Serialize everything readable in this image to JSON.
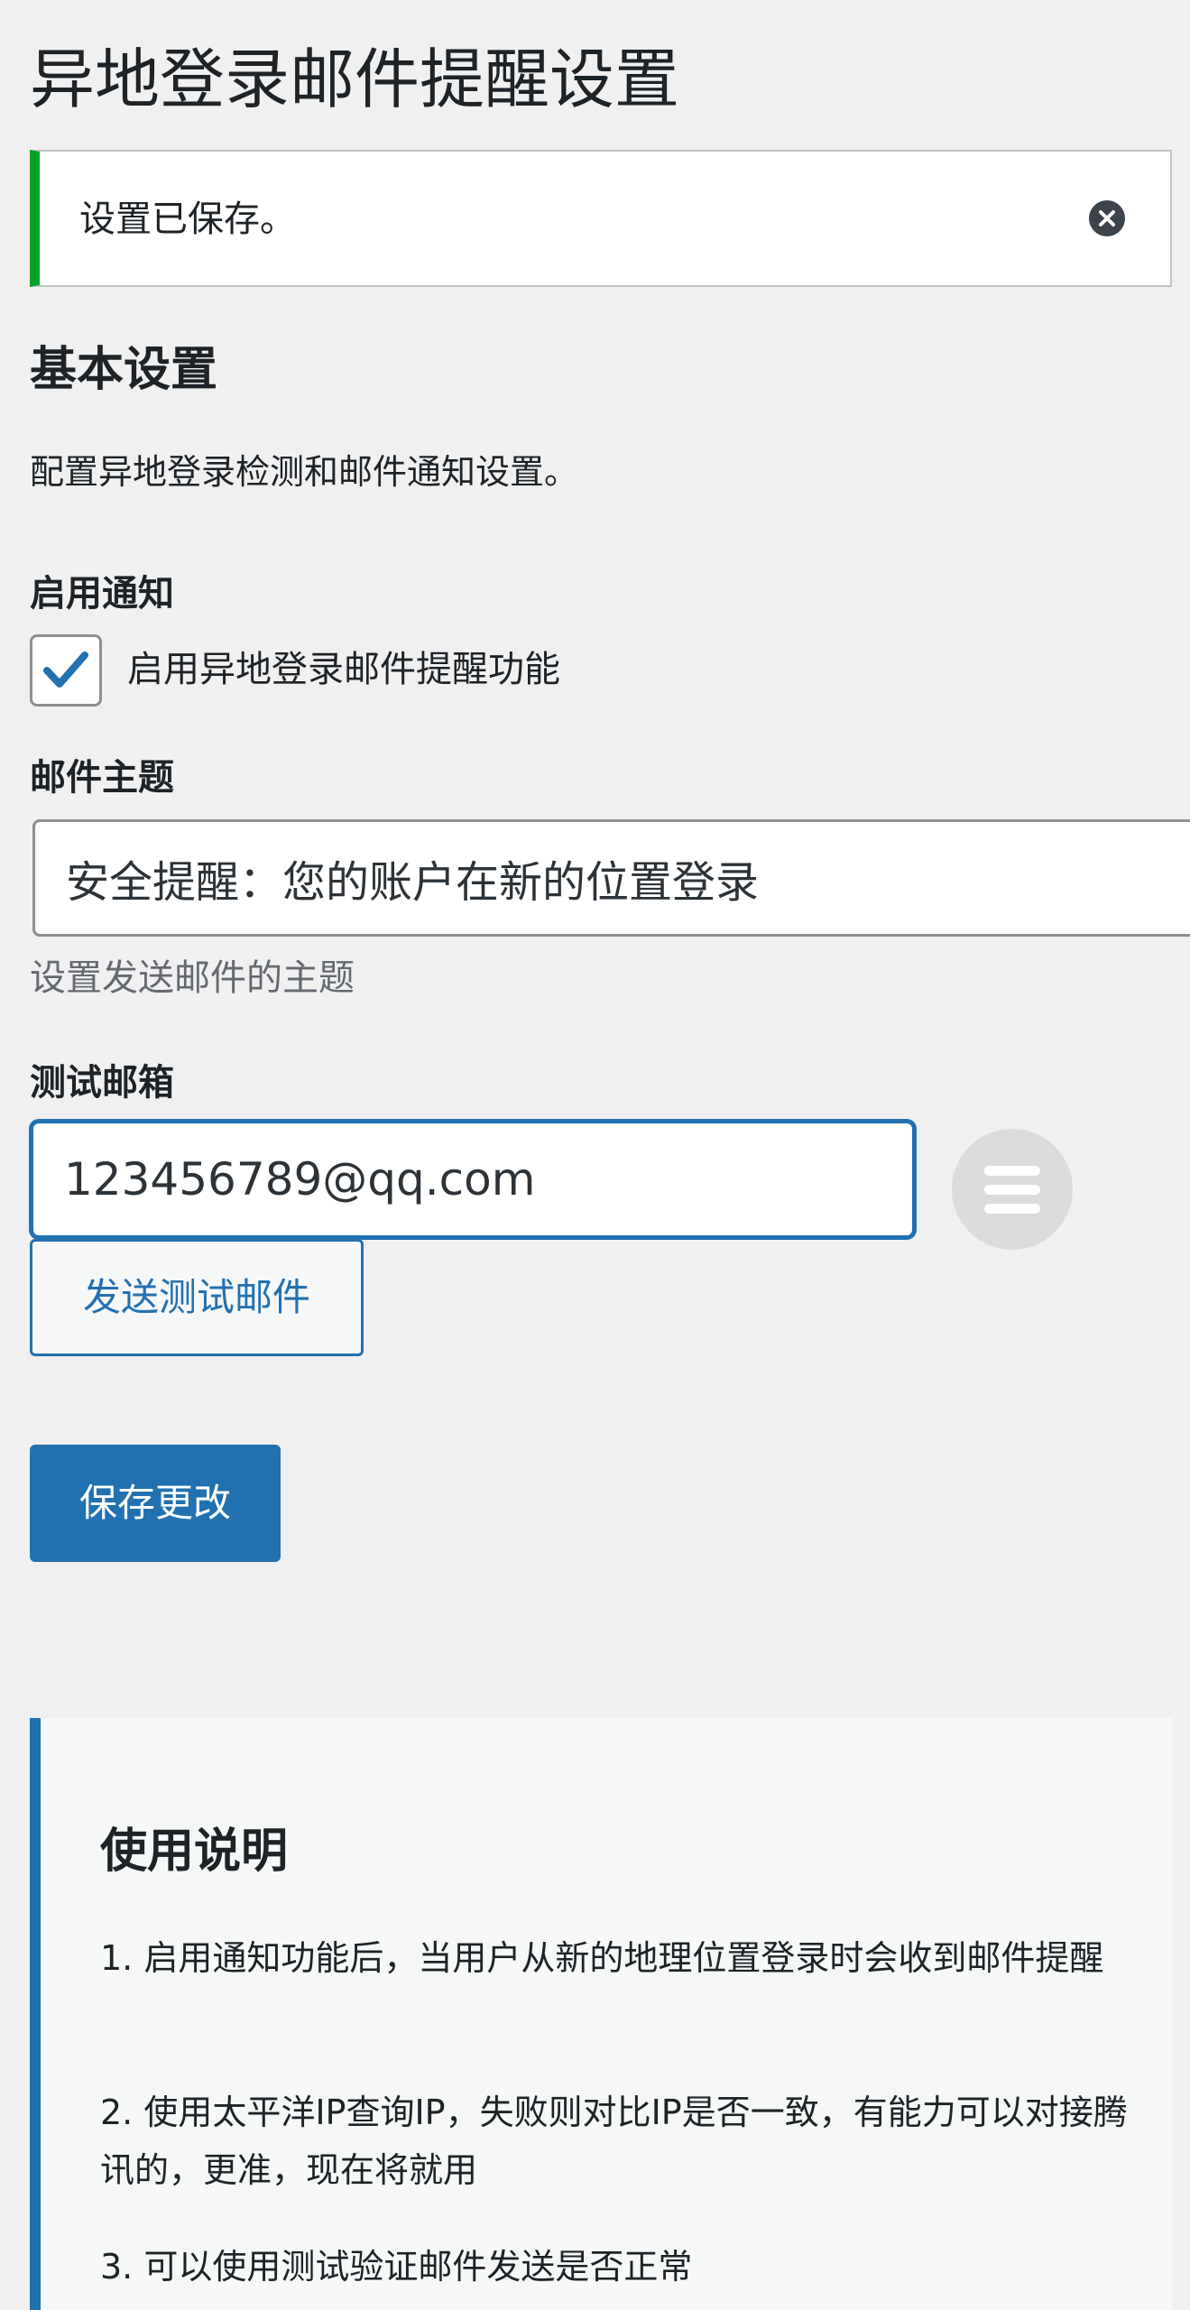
{
  "page": {
    "title": "异地登录邮件提醒设置"
  },
  "notice": {
    "text": "设置已保存。",
    "dismiss_icon": "close-circle-icon",
    "accent_color": "#00a32a"
  },
  "basic_settings": {
    "title": "基本设置",
    "description": "配置异地登录检测和邮件通知设置。"
  },
  "enable_notify": {
    "label": "启用通知",
    "checkbox_label": "启用异地登录邮件提醒功能",
    "checked": true
  },
  "mail_subject": {
    "label": "邮件主题",
    "value": "安全提醒：您的账户在新的位置登录",
    "help": "设置发送邮件的主题"
  },
  "test_email": {
    "label": "测试邮箱",
    "value": "123456789@qq.com",
    "send_button": "发送测试邮件",
    "fab_icon": "menu-icon"
  },
  "save_button": "保存更改",
  "usage": {
    "title": "使用说明",
    "items": [
      "1. 启用通知功能后，当用户从新的地理位置登录时会收到邮件提醒",
      "2. 使用太平洋IP查询IP，失败则对比IP是否一致，有能力可以对接腾讯的，更准，现在将就用",
      "3. 可以使用测试验证邮件发送是否正常"
    ]
  },
  "colors": {
    "primary": "#2271b1",
    "background": "#f0f0f1",
    "success": "#00a32a"
  }
}
